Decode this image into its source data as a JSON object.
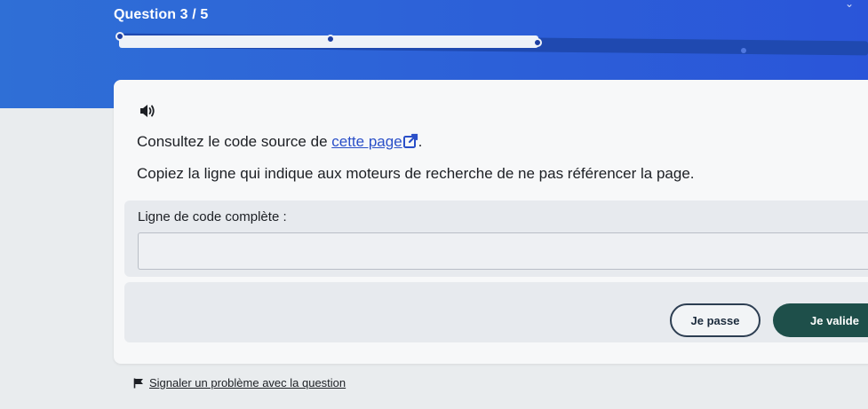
{
  "header": {
    "question_counter": "Question 3 / 5"
  },
  "progress": {
    "current": 3,
    "total": 5,
    "fill_fraction": 0.56
  },
  "question": {
    "instruction_prefix": "Consultez le code source de ",
    "link_text": "cette page",
    "instruction_suffix": ".",
    "instruction_2": "Copiez la ligne qui indique aux moteurs de recherche de ne pas référencer la page."
  },
  "answer": {
    "label": "Ligne de code complète :",
    "value": "",
    "placeholder": ""
  },
  "actions": {
    "skip_label": "Je passe",
    "validate_label": "Je valide"
  },
  "footer": {
    "report_label": "Signaler un problème avec la question"
  },
  "icons": {
    "speaker": "speaker-icon",
    "external_link": "external-link-icon",
    "flag": "flag-icon"
  },
  "colors": {
    "header": "#2d63d8",
    "validate_button": "#1e4f4a",
    "link": "#2a4fc8"
  }
}
